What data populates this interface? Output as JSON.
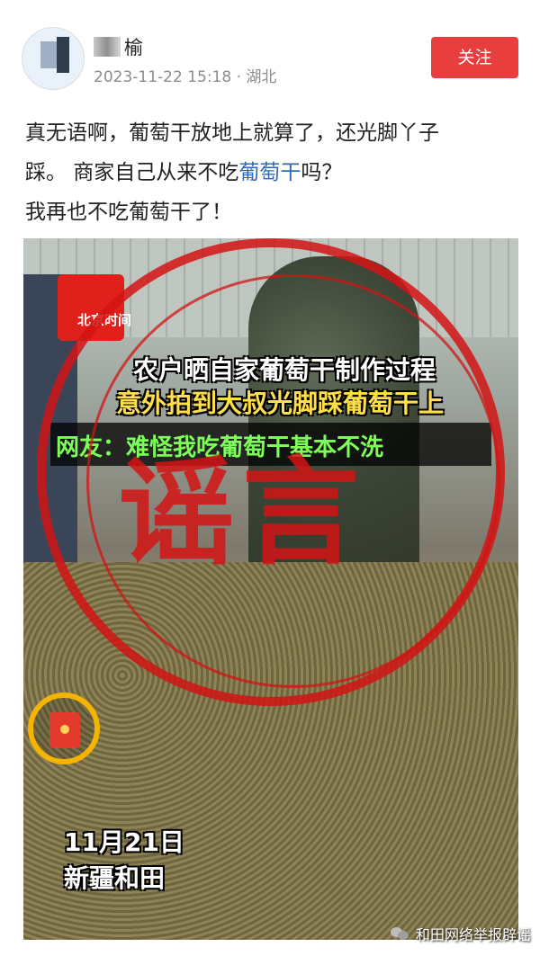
{
  "header": {
    "username": "榆",
    "timestamp": "2023-11-22 15:18",
    "location": "湖北",
    "follow_label": "关注"
  },
  "post": {
    "line1": "真无语啊，葡萄干放地上就算了，还光脚丫子",
    "line2_a": "踩。 商家自己从来不吃",
    "line2_link": "葡萄干",
    "line2_b": "吗？",
    "line3": "我再也不吃葡萄干了！"
  },
  "media": {
    "source_badge": "北京时间",
    "caption_1": "农户晒自家葡萄干制作过程",
    "caption_2": "意外拍到大叔光脚踩葡萄干上",
    "caption_3": "网友：难怪我吃葡萄干基本不洗",
    "stamp": "谣言",
    "date": "11月21日",
    "place": "新疆和田"
  },
  "watermark": "和田网络举报辟谣",
  "colors": {
    "follow_bg": "#e83e3e",
    "link": "#2e6bb4",
    "stamp": "#d21414"
  }
}
